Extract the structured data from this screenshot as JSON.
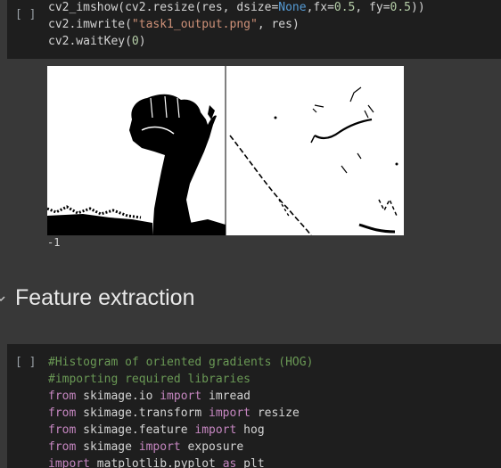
{
  "cell1": {
    "run_label": "[ ]",
    "lines": [
      [
        {
          "t": "cv2_imshow(cv2.resize(res, dsize=",
          "c": ""
        },
        {
          "t": "None",
          "c": "const"
        },
        {
          "t": ",fx=",
          "c": ""
        },
        {
          "t": "0.5",
          "c": "num"
        },
        {
          "t": ", fy=",
          "c": ""
        },
        {
          "t": "0.5",
          "c": "num"
        },
        {
          "t": "))",
          "c": ""
        }
      ],
      [
        {
          "t": "cv2.imwrite(",
          "c": ""
        },
        {
          "t": "\"task1_output.png\"",
          "c": "str"
        },
        {
          "t": ", res)",
          "c": ""
        }
      ],
      [
        {
          "t": "cv2.waitKey(",
          "c": ""
        },
        {
          "t": "0",
          "c": "num"
        },
        {
          "t": ")",
          "c": ""
        }
      ]
    ]
  },
  "output": {
    "return_value": "-1"
  },
  "section": {
    "title": "Feature extraction"
  },
  "cell2": {
    "run_label": "[ ]",
    "lines": [
      [
        {
          "t": "#Histogram of oriented gradients (HOG)",
          "c": "comment"
        }
      ],
      [
        {
          "t": "#importing required libraries",
          "c": "comment"
        }
      ],
      [
        {
          "t": "from",
          "c": "kw"
        },
        {
          "t": " skimage.io ",
          "c": ""
        },
        {
          "t": "import",
          "c": "kw"
        },
        {
          "t": " imread",
          "c": ""
        }
      ],
      [
        {
          "t": "from",
          "c": "kw"
        },
        {
          "t": " skimage.transform ",
          "c": ""
        },
        {
          "t": "import",
          "c": "kw"
        },
        {
          "t": " resize",
          "c": ""
        }
      ],
      [
        {
          "t": "from",
          "c": "kw"
        },
        {
          "t": " skimage.feature ",
          "c": ""
        },
        {
          "t": "import",
          "c": "kw"
        },
        {
          "t": " hog",
          "c": ""
        }
      ],
      [
        {
          "t": "from",
          "c": "kw"
        },
        {
          "t": " skimage ",
          "c": ""
        },
        {
          "t": "import",
          "c": "kw"
        },
        {
          "t": " exposure",
          "c": ""
        }
      ],
      [
        {
          "t": "import",
          "c": "kw"
        },
        {
          "t": " matplotlib.pyplot ",
          "c": ""
        },
        {
          "t": "as",
          "c": "kw"
        },
        {
          "t": " plt",
          "c": ""
        }
      ]
    ]
  }
}
